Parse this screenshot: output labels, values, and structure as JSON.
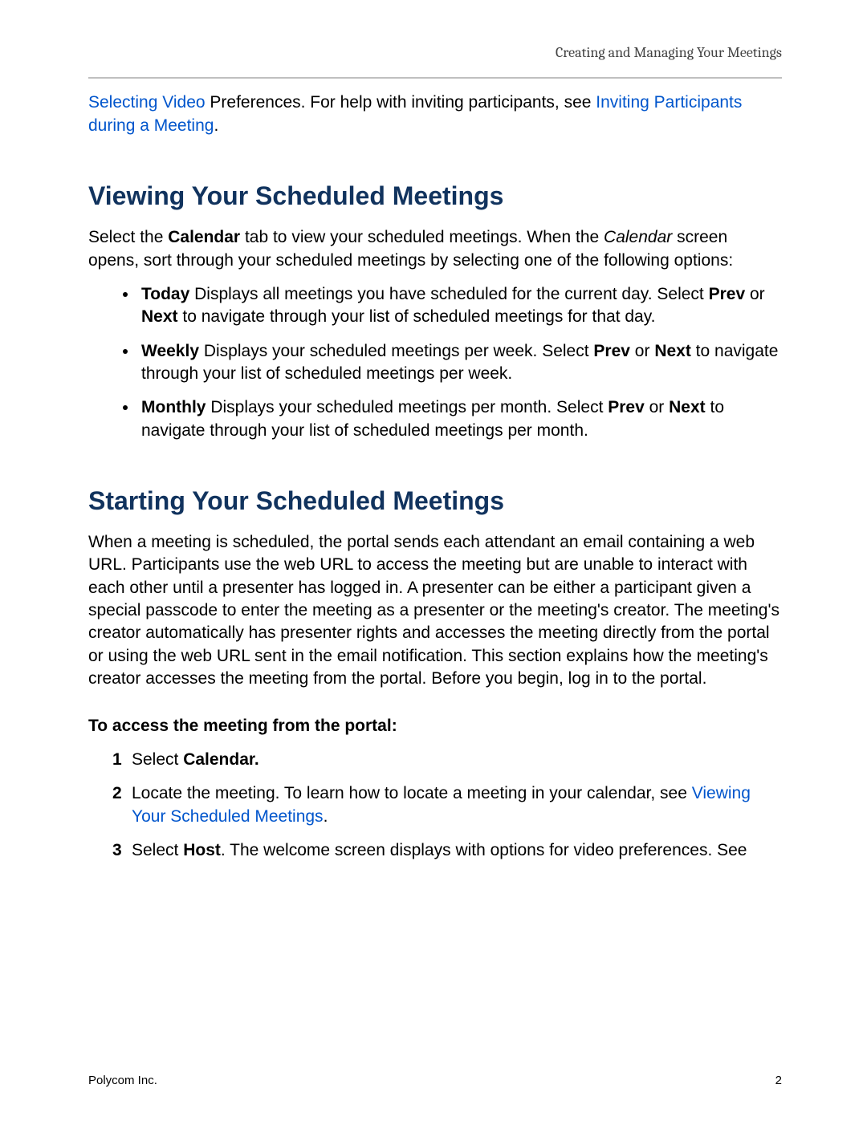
{
  "header": {
    "running_title": "Creating and Managing Your Meetings"
  },
  "intro": {
    "link1": "Selecting Video",
    "mid1": " Preferences. For help with inviting participants, see ",
    "link2": "Inviting Participants during a Meeting",
    "tail": "."
  },
  "section1": {
    "title": "Viewing Your Scheduled Meetings",
    "para_a": "Select the ",
    "para_b_bold": "Calendar",
    "para_c": " tab to view your scheduled meetings. When the ",
    "para_d_ital": "Calendar",
    "para_e": " screen opens, sort through your scheduled meetings by selecting one of the following options:",
    "bullets": [
      {
        "lead_bold": "Today",
        "text_a": "    Displays all meetings you have scheduled for the current day. Select ",
        "b1": "Prev",
        "text_b": " or ",
        "b2": "Next",
        "text_c": " to navigate through your list of scheduled meetings for that day."
      },
      {
        "lead_bold": "Weekly",
        "text_a": "    Displays your scheduled meetings per week. Select ",
        "b1": "Prev",
        "text_b": " or ",
        "b2": "Next",
        "text_c": " to navigate through your list of scheduled meetings per week."
      },
      {
        "lead_bold": "Monthly",
        "text_a": "    Displays your scheduled meetings per month. Select ",
        "b1": "Prev",
        "text_b": " or ",
        "b2": "Next",
        "text_c": " to navigate through your list of scheduled meetings per month."
      }
    ]
  },
  "section2": {
    "title": "Starting Your Scheduled Meetings",
    "para": "When a meeting is scheduled, the portal sends each attendant an email containing a web URL. Participants use the web URL to access the meeting but are unable to interact with each other until a presenter has logged in. A presenter can be either a participant given a special passcode to enter the meeting as a presenter or the meeting's creator. The meeting's creator automatically has presenter rights and accesses the meeting directly from the portal or using the web URL sent in the email notification. This section explains how the meeting's creator accesses the meeting from the portal. Before you begin, log in to the portal.",
    "subhead": "To access the meeting from the portal:",
    "steps": {
      "s1_a": "Select ",
      "s1_b_bold": "Calendar.",
      "s2_a": "Locate the meeting. To learn how to locate a meeting in your calendar, see ",
      "s2_link": "Viewing Your Scheduled Meetings",
      "s2_tail": ".",
      "s3_a": "Select ",
      "s3_b_bold": "Host",
      "s3_c": ". The welcome screen displays with options for video preferences. See"
    }
  },
  "footer": {
    "left": "Polycom Inc.",
    "right": "2"
  }
}
